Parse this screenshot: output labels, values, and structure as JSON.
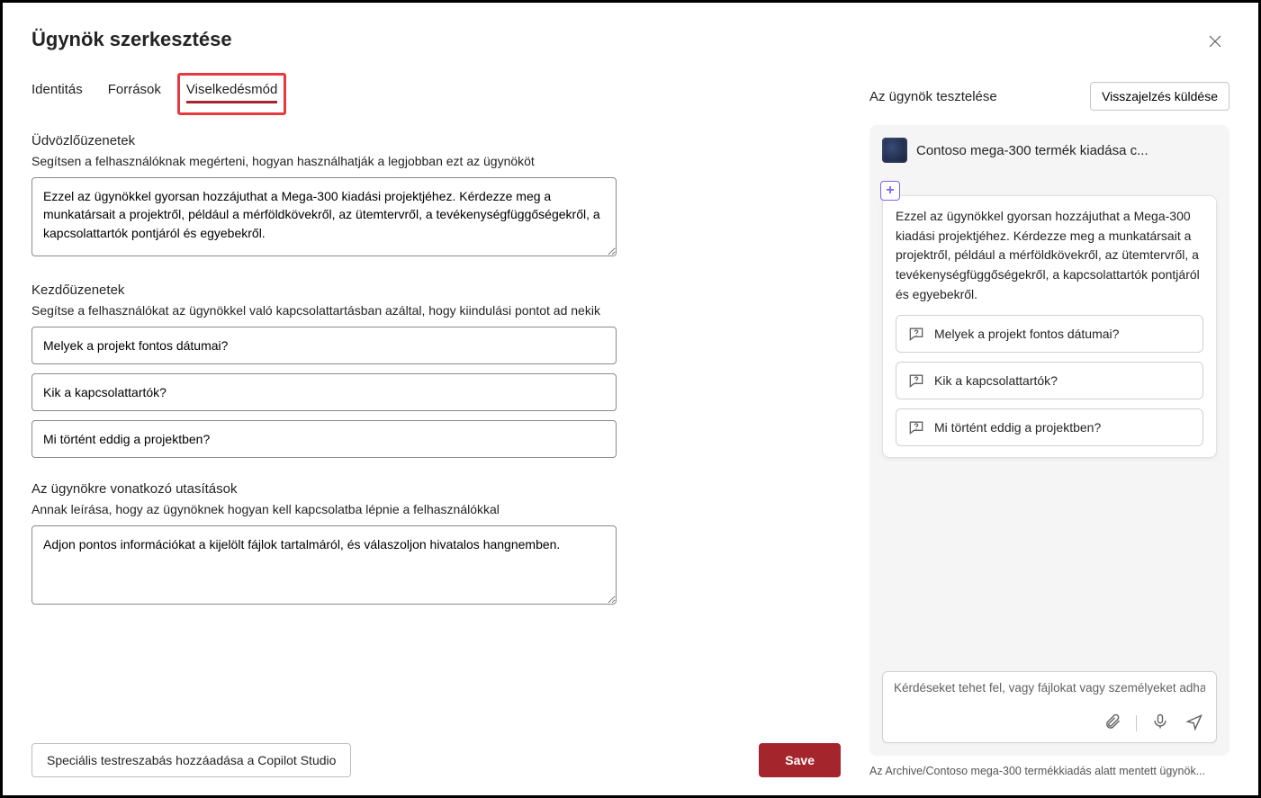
{
  "page_title": "Ügynök szerkesztése",
  "tabs": [
    {
      "label": "Identitás",
      "active": false
    },
    {
      "label": "Források",
      "active": false
    },
    {
      "label": "Viselkedésmód",
      "active": true,
      "highlighted": true
    }
  ],
  "sections": {
    "welcome": {
      "label": "Üdvözlőüzenetek",
      "help": "Segítsen a felhasználóknak megérteni, hogyan használhatják a legjobban ezt az ügynököt",
      "value": "Ezzel az ügynökkel gyorsan hozzájuthat a Mega-300 kiadási projektjéhez. Kérdezze meg a munkatársait a projektről, például a mérföldkövekről, az ütemtervről, a tevékenységfüggőségekről, a kapcsolattartók pontjáról és egyebekről."
    },
    "starter": {
      "label": "Kezdőüzenetek",
      "help": "Segítse a felhasználókat az ügynökkel való kapcsolattartásban azáltal, hogy kiindulási pontot ad nekik",
      "items": [
        "Melyek a projekt fontos dátumai?",
        "Kik a kapcsolattartók?",
        "Mi történt eddig a projektben?"
      ]
    },
    "instructions": {
      "label": "Az ügynökre vonatkozó utasítások",
      "help": "Annak leírása, hogy az ügynöknek hogyan kell kapcsolatba lépnie a felhasználókkal",
      "value": "Adjon pontos információkat a kijelölt fájlok tartalmáról, és válaszoljon hivatalos hangnemben."
    }
  },
  "footer": {
    "advanced_button": "Speciális testreszabás hozzáadása a Copilot Studio",
    "save_button": "Save"
  },
  "test_panel": {
    "title": "Az ügynök tesztelése",
    "feedback_button": "Visszajelzés küldése",
    "agent_name": "Contoso mega-300 termék kiadása c...",
    "greeting_text": "Ezzel az ügynökkel gyorsan hozzájuthat a Mega-300 kiadási projektjéhez. Kérdezze meg a munkatársait a projektről, például a mérföldkövekről, az ütemtervről, a tevékenységfüggőségekről, a kapcsolattartók pontjáról és egyebekről.",
    "prompts": [
      "Melyek a projekt fontos dátumai?",
      "Kik a kapcsolattartók?",
      "Mi történt eddig a projektben?"
    ],
    "input_placeholder": "Kérdéseket tehet fel, vagy fájlokat vagy személyeket adhat hozzá.",
    "save_path": "Az Archive/Contoso mega-300 termékkiadás alatt mentett ügynök..."
  }
}
